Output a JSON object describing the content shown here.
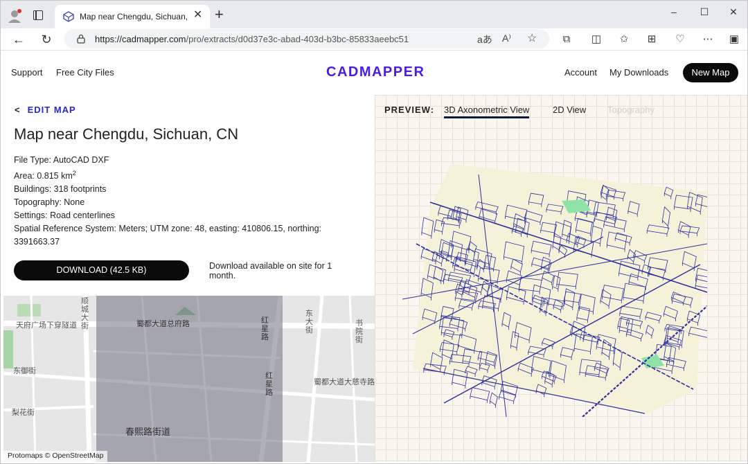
{
  "browser": {
    "tab_title": "Map near Chengdu, Sichuan, CN",
    "tab_close": "✕",
    "new_tab": "+",
    "url_host": "https://cadmapper.com",
    "url_path": "/pro/extracts/d0d37e3c-abad-403d-b3bc-85833aeebc51",
    "window_controls": {
      "minimize": "–",
      "maximize": "☐",
      "close": "✕"
    },
    "icons": {
      "back": "back-arrow-icon",
      "reload": "reload-icon",
      "lock": "lock-icon",
      "translate": "translate-icon",
      "read_aloud": "read-aloud-icon",
      "favorite": "star-icon",
      "extensions": "puzzle-icon",
      "split": "split-screen-icon",
      "favorites": "favorites-icon",
      "collections": "collections-icon",
      "health": "heart-icon",
      "more": "more-icon",
      "sidebar": "sidebar-icon"
    }
  },
  "header": {
    "links_left": [
      "Support",
      "Free City Files"
    ],
    "logo": "CADMAPPER",
    "links_right": [
      "Account",
      "My Downloads"
    ],
    "new_map_label": "New Map"
  },
  "extract": {
    "edit_label": "EDIT MAP",
    "title": "Map near Chengdu, Sichuan, CN",
    "file_type": "File Type: AutoCAD DXF",
    "area_prefix": "Area: 0.815 km",
    "area_sup": "2",
    "buildings": "Buildings: 318 footprints",
    "topography": "Topography: None",
    "settings": "Settings: Road centerlines",
    "srs": "Spatial Reference System: Meters; UTM zone: 48, easting: 410806.15, northing: 3391663.37",
    "download_label": "DOWNLOAD (42.5 KB)",
    "download_note": "Download available on site for 1 month."
  },
  "minimap": {
    "labels": [
      "天府广场下穿隧道",
      "顺城大街",
      "东御街",
      "梨花街",
      "蜀都大道总府路",
      "春熙路街道",
      "红星路",
      "红星路",
      "蜀都大道大慈寺路",
      "东大街",
      "书院街"
    ],
    "attribution": "Protomaps © OpenStreetMap"
  },
  "preview": {
    "label": "PREVIEW:",
    "tabs": [
      "3D Axonometric View",
      "2D View",
      "Topography"
    ],
    "active_tab": 0,
    "line_color": "#2d2f9e",
    "green_color": "#8fe3a8",
    "ground_color": "#f6f2da"
  }
}
